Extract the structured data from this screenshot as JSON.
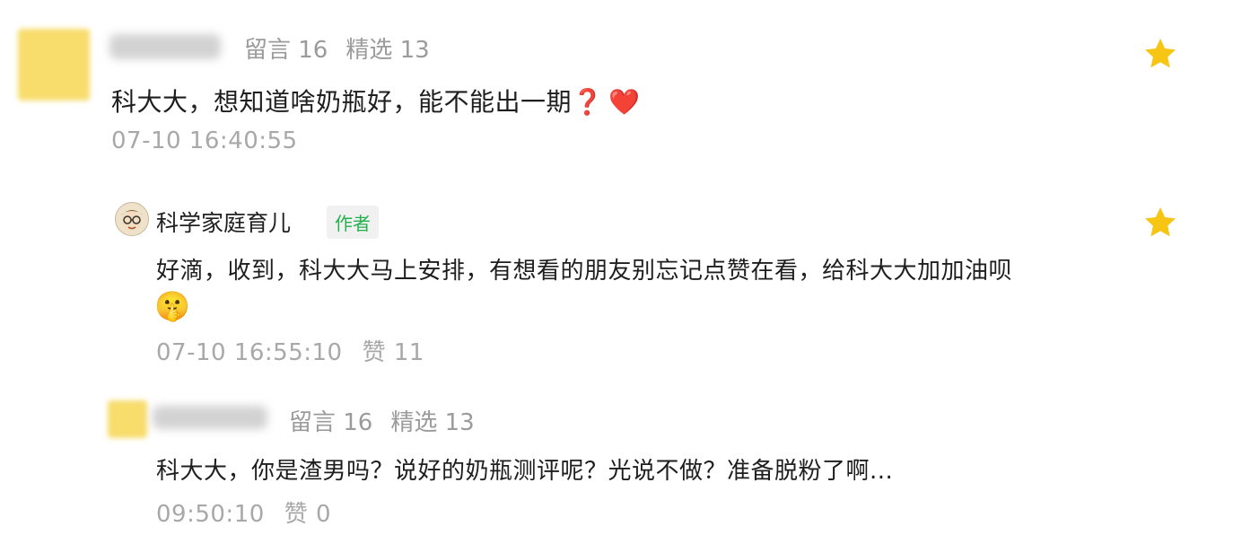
{
  "comments": [
    {
      "stats_left": "留言 16",
      "stats_right": "精选 13",
      "text": "科大大，想知道啥奶瓶好，能不能出一期",
      "emoji_1": "❓",
      "emoji_2": "❤️",
      "time": "07-10 16:40:55"
    },
    {
      "stats_left": "留言 16",
      "stats_right": "精选 13",
      "text": "科大大，你是渣男吗？说好的奶瓶测评呢？光说不做？准备脱粉了啊...",
      "time": "09:50:10",
      "like": "赞 0"
    }
  ],
  "reply": {
    "author": "科学家庭育儿",
    "author_tag": "作者",
    "text": "好滴，收到，科大大马上安排，有想看的朋友别忘记点赞在看，给科大大加加油呗",
    "emoji": "🤫",
    "time": "07-10 16:55:10",
    "like": "赞 11"
  },
  "icons": {
    "star": "star-icon",
    "star_color": "#f7c514"
  }
}
